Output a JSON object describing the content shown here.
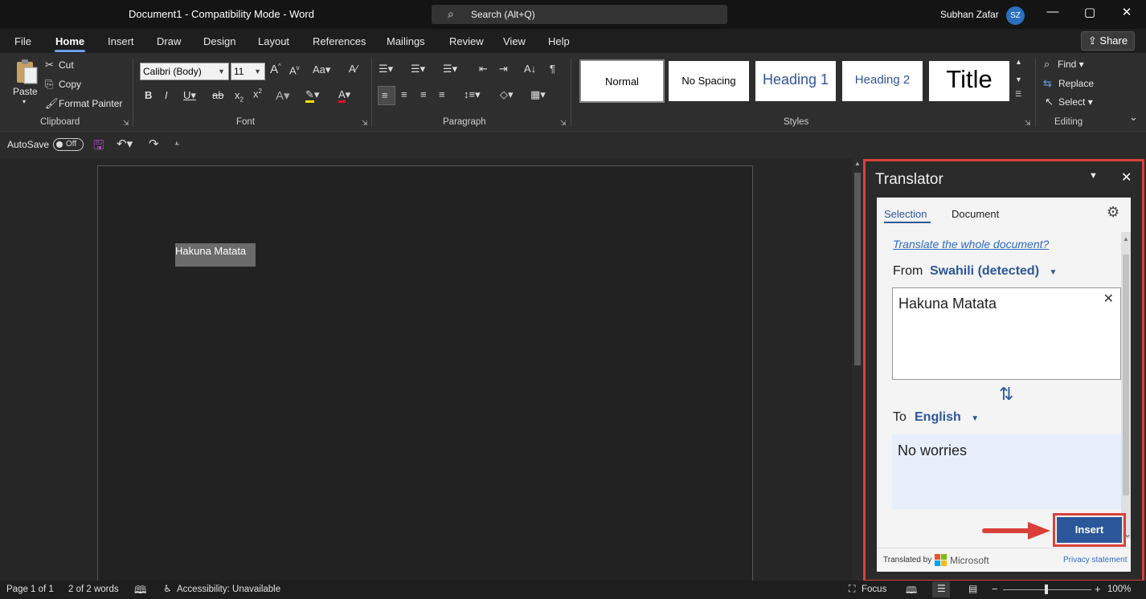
{
  "titlebar": {
    "title": "Document1  -  Compatibility Mode  -  Word",
    "search_placeholder": "Search (Alt+Q)",
    "user_name": "Subhan Zafar",
    "user_initials": "SZ"
  },
  "menu": {
    "tabs": [
      "File",
      "Home",
      "Insert",
      "Draw",
      "Design",
      "Layout",
      "References",
      "Mailings",
      "Review",
      "View",
      "Help"
    ],
    "share_label": "Share"
  },
  "ribbon": {
    "clipboard": {
      "paste": "Paste",
      "cut": "Cut",
      "copy": "Copy",
      "format_painter": "Format Painter",
      "label": "Clipboard"
    },
    "font": {
      "font_name": "Calibri (Body)",
      "font_size": "11",
      "label": "Font"
    },
    "paragraph": {
      "label": "Paragraph"
    },
    "styles": {
      "items": [
        "Normal",
        "No Spacing",
        "Heading 1",
        "Heading 2",
        "Title"
      ],
      "label": "Styles"
    },
    "editing": {
      "find": "Find",
      "replace": "Replace",
      "select": "Select",
      "label": "Editing"
    }
  },
  "qat": {
    "autosave": "AutoSave",
    "autosave_state": "Off"
  },
  "document": {
    "selected_text": "Hakuna Matata"
  },
  "translator": {
    "title": "Translator",
    "tab_selection": "Selection",
    "tab_document": "Document",
    "translate_doc_link": "Translate the whole document?",
    "from_label": "From",
    "from_language": "Swahili (detected)",
    "source_text": "Hakuna Matata",
    "to_label": "To",
    "to_language": "English",
    "translated_text": "No worries",
    "insert_label": "Insert",
    "translated_by": "Translated by",
    "provider": "Microsoft",
    "privacy": "Privacy statement"
  },
  "status": {
    "page": "Page 1 of 1",
    "words": "2 of 2 words",
    "accessibility": "Accessibility: Unavailable",
    "focus": "Focus",
    "zoom": "100%"
  },
  "colors": {
    "accent": "#2b579a",
    "highlight_border": "#d9403a",
    "link": "#2e6bc4"
  }
}
